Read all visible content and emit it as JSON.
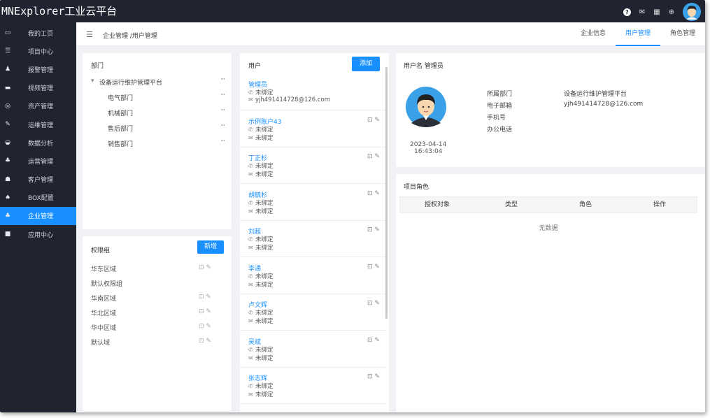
{
  "app": {
    "title": "MNExplorer工业云平台"
  },
  "topbar": {
    "icons": [
      "help-icon",
      "mail-icon",
      "grid-icon",
      "globe-icon"
    ],
    "glyphs": [
      "?",
      "✉",
      "▦",
      "⊕"
    ]
  },
  "sidebar": {
    "items": [
      {
        "label": "我的工页",
        "icon": "▭",
        "icon_name": "monitor-icon"
      },
      {
        "label": "项目中心",
        "icon": "☰",
        "icon_name": "list-icon"
      },
      {
        "label": "报警管理",
        "icon": "♟",
        "icon_name": "bell-icon"
      },
      {
        "label": "视频管理",
        "icon": "▬",
        "icon_name": "video-icon"
      },
      {
        "label": "资产管理",
        "icon": "◎",
        "icon_name": "asset-icon"
      },
      {
        "label": "运维管理",
        "icon": "✎",
        "icon_name": "wrench-icon"
      },
      {
        "label": "数据分析",
        "icon": "◒",
        "icon_name": "chart-icon"
      },
      {
        "label": "运营管理",
        "icon": "♣",
        "icon_name": "operation-icon"
      },
      {
        "label": "客户管理",
        "icon": "☗",
        "icon_name": "customer-icon"
      },
      {
        "label": "BOX配置",
        "icon": "♠",
        "icon_name": "box-icon"
      },
      {
        "label": "企业管理",
        "icon": "♣",
        "icon_name": "enterprise-icon",
        "active": true
      },
      {
        "label": "应用中心",
        "icon": "■",
        "icon_name": "app-icon"
      }
    ]
  },
  "header": {
    "breadcrumb": "企业管理 /用户管理",
    "tabs": [
      {
        "label": "企业信息"
      },
      {
        "label": "用户管理",
        "active": true
      },
      {
        "label": "角色管理"
      }
    ]
  },
  "departments": {
    "title": "部门",
    "root": "设备运行维护管理平台",
    "children": [
      "电气部门",
      "机械部门",
      "售后部门",
      "销售部门"
    ],
    "more": "···"
  },
  "auth_groups": {
    "title": "权限组",
    "add_label": "新增",
    "items": [
      {
        "name": "华东区域",
        "ops": "⊡ ✎"
      },
      {
        "name": "默认权限组",
        "ops": ""
      },
      {
        "name": "华南区域",
        "ops": "⊡ ✎"
      },
      {
        "name": "华北区域",
        "ops": "⊡ ✎"
      },
      {
        "name": "华中区域",
        "ops": "⊡ ✎"
      },
      {
        "name": "默认域",
        "ops": "⊡ ✎"
      }
    ]
  },
  "users": {
    "title": "用户",
    "add_label": "添加",
    "action_label": "⊡ ✎",
    "phone_glyph": "✆",
    "mail_glyph": "✉",
    "items": [
      {
        "name": "管理员",
        "phone": "未绑定",
        "email": "yjh491414728@126.com",
        "show_action": false
      },
      {
        "name": "示例账户43",
        "phone": "未绑定",
        "email": "未绑定",
        "show_action": true
      },
      {
        "name": "丁正杉",
        "phone": "未绑定",
        "email": "未绑定",
        "show_action": true
      },
      {
        "name": "胡毓杉",
        "phone": "未绑定",
        "email": "未绑定",
        "show_action": true
      },
      {
        "name": "刘超",
        "phone": "未绑定",
        "email": "未绑定",
        "show_action": true
      },
      {
        "name": "李通",
        "phone": "未绑定",
        "email": "未绑定",
        "show_action": true
      },
      {
        "name": "卢文辉",
        "phone": "未绑定",
        "email": "未绑定",
        "show_action": true
      },
      {
        "name": "吴斌",
        "phone": "未绑定",
        "email": "未绑定",
        "show_action": true
      },
      {
        "name": "张志辉",
        "phone": "未绑定",
        "email": "未绑定",
        "show_action": true
      }
    ]
  },
  "user_detail": {
    "header": "用户名  管理员",
    "date": "2023-04-14",
    "time": "16:43:04",
    "fields": [
      {
        "label": "所属部门",
        "value": "设备运行维护管理平台"
      },
      {
        "label": "电子邮箱",
        "value": "yjh491414728@126.com"
      },
      {
        "label": "手机号",
        "value": ""
      },
      {
        "label": "办公电话",
        "value": ""
      }
    ]
  },
  "project_roles": {
    "title": "项目角色",
    "columns": [
      "授权对象",
      "类型",
      "角色",
      "操作"
    ],
    "empty_text": "无数据"
  },
  "colors": {
    "accent": "#1890ff",
    "sidebar_bg": "#1f2430"
  }
}
